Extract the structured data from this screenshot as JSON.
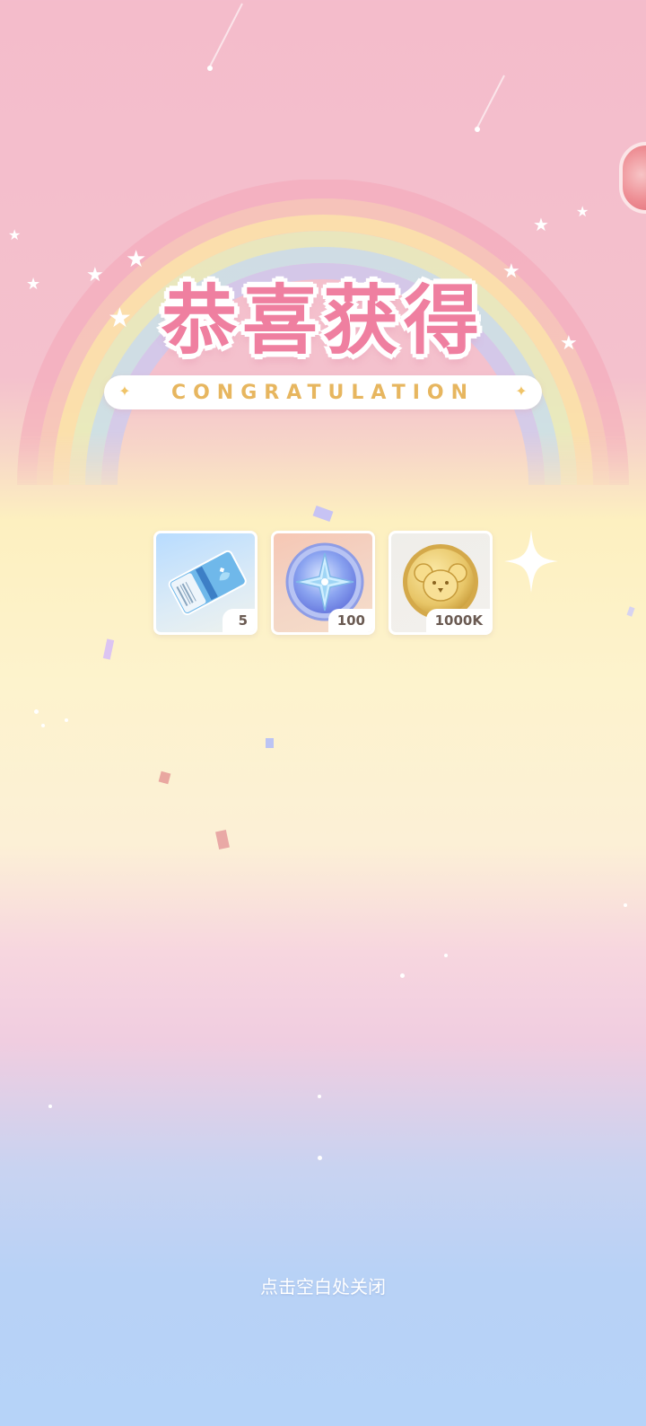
{
  "title": {
    "main": "恭喜获得",
    "subtitle": "CONGRATULATION"
  },
  "rewards": [
    {
      "icon": "ticket-icon",
      "quantity": "5"
    },
    {
      "icon": "compass-star-medal-icon",
      "quantity": "100"
    },
    {
      "icon": "koala-gold-coin-icon",
      "quantity": "1000K"
    }
  ],
  "close_hint": "点击空白处关闭",
  "colors": {
    "title_pink": "#ef7fa0",
    "subtitle_gold": "#e7b65f",
    "qty_text": "#6a5a52"
  }
}
